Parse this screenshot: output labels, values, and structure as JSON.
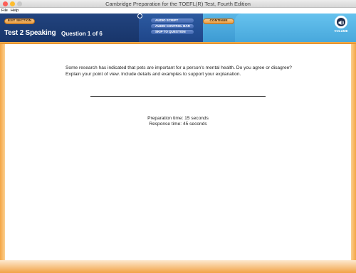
{
  "window": {
    "title": "Cambridge Preparation for the TOEFL(R) Test, Fourth Edition"
  },
  "menu": {
    "items": [
      "File",
      "Help"
    ]
  },
  "header": {
    "exit_label": "EXIT SECTION",
    "continue_label": "CONTINUE",
    "section_title": "Test 2 Speaking",
    "question_counter": "Question 1 of 6",
    "buttons": [
      "AUDIO SCRIPT",
      "AUDIO CONTROL BAR",
      "SKIP TO QUESTION"
    ],
    "volume_label": "VOLUME",
    "volume_icon": "speaker-icon"
  },
  "prompt": {
    "text": "Some research has indicated that pets are important for a person's mental health. Do you agree or disagree? Explain your point of view. Include details and examples to support your explanation.",
    "preparation_time": "Preparation time: 15 seconds",
    "response_time": "Response time: 45 seconds"
  },
  "colors": {
    "header_navy": "#1d3f7a",
    "header_light_blue": "#48a8dc",
    "accent_orange": "#e89a3e"
  }
}
